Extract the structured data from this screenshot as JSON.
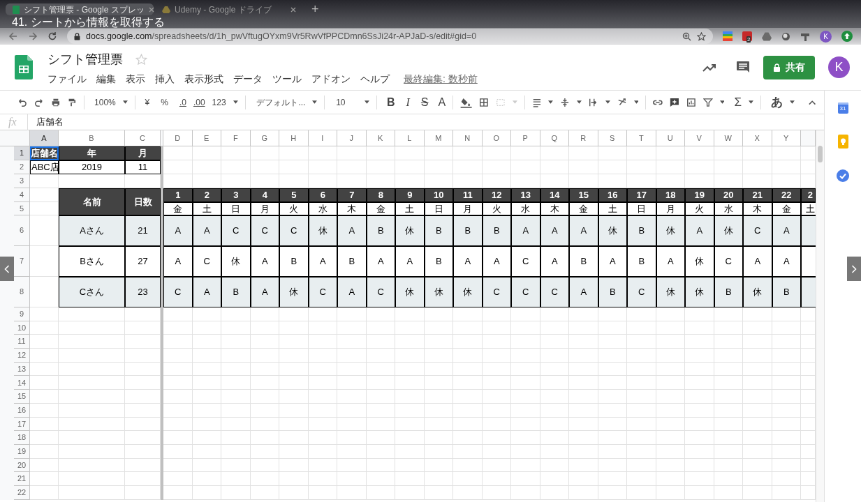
{
  "video_title": "41. シートから情報を取得する",
  "browser": {
    "tabs": [
      {
        "title": "シフト管理票 - Google スプレッ",
        "selected": true
      },
      {
        "title": "Udemy - Google ドライブ",
        "selected": false
      }
    ],
    "new_tab": "+",
    "url_host": "docs.google.com",
    "url_path": "/spreadsheets/d/1h_pwVftugOYxm9Vr5RwVfPPCDmn6SsJi24r-APJaD-s/edit#gid=0",
    "extension_badge": "2",
    "profile_initial": "K"
  },
  "doc": {
    "title": "シフト管理票",
    "menu": [
      "ファイル",
      "編集",
      "表示",
      "挿入",
      "表示形式",
      "データ",
      "ツール",
      "アドオン",
      "ヘルプ"
    ],
    "last_edit": "最終編集: 数秒前",
    "share_label": "共有",
    "avatar_initial": "K"
  },
  "toolbar": {
    "zoom": "100%",
    "currency": "¥",
    "percent": "%",
    "decimal_less": ".0",
    "decimal_more": ".00",
    "number_format": "123",
    "font": "デフォルト...",
    "font_size": "10",
    "bold": "B",
    "italic": "I",
    "strike": "S",
    "text_color": "A",
    "function": "Σ",
    "input_tool": "あ"
  },
  "formula_bar": {
    "fx": "fx",
    "value": "店舗名"
  },
  "sheet": {
    "columns": [
      {
        "label": "A",
        "selected": true
      },
      {
        "label": "B",
        "selected": false
      },
      {
        "label": "C",
        "selected": false
      },
      {
        "label": "D",
        "selected": false
      },
      {
        "label": "E",
        "selected": false
      },
      {
        "label": "F",
        "selected": false
      },
      {
        "label": "G",
        "selected": false
      },
      {
        "label": "H",
        "selected": false
      },
      {
        "label": "I",
        "selected": false
      },
      {
        "label": "J",
        "selected": false
      },
      {
        "label": "K",
        "selected": false
      },
      {
        "label": "L",
        "selected": false
      },
      {
        "label": "M",
        "selected": false
      },
      {
        "label": "N",
        "selected": false
      },
      {
        "label": "O",
        "selected": false
      },
      {
        "label": "P",
        "selected": false
      },
      {
        "label": "Q",
        "selected": false
      },
      {
        "label": "R",
        "selected": false
      },
      {
        "label": "S",
        "selected": false
      },
      {
        "label": "T",
        "selected": false
      },
      {
        "label": "U",
        "selected": false
      },
      {
        "label": "V",
        "selected": false
      },
      {
        "label": "W",
        "selected": false
      },
      {
        "label": "X",
        "selected": false
      },
      {
        "label": "Y",
        "selected": false
      }
    ],
    "rows": [
      {
        "label": "1",
        "selected": true
      },
      {
        "label": "2",
        "selected": false
      },
      {
        "label": "3",
        "selected": false
      },
      {
        "label": "4",
        "selected": false
      },
      {
        "label": "5",
        "selected": false
      },
      {
        "label": "6",
        "selected": false
      },
      {
        "label": "7",
        "selected": false
      },
      {
        "label": "8",
        "selected": false
      },
      {
        "label": "9",
        "selected": false
      },
      {
        "label": "10",
        "selected": false
      },
      {
        "label": "11",
        "selected": false
      },
      {
        "label": "12",
        "selected": false
      },
      {
        "label": "13",
        "selected": false
      },
      {
        "label": "14",
        "selected": false
      },
      {
        "label": "15",
        "selected": false
      },
      {
        "label": "16",
        "selected": false
      },
      {
        "label": "17",
        "selected": false
      },
      {
        "label": "18",
        "selected": false
      },
      {
        "label": "19",
        "selected": false
      },
      {
        "label": "20",
        "selected": false
      },
      {
        "label": "21",
        "selected": false
      },
      {
        "label": "22",
        "selected": false
      }
    ],
    "info_headers": [
      "店舗名",
      "年",
      "月"
    ],
    "info_values": [
      "ABC店",
      "2019",
      "11"
    ],
    "staff_headers": [
      "名前",
      "日数"
    ],
    "days": [
      {
        "day": "1",
        "weekday": "金"
      },
      {
        "day": "2",
        "weekday": "土"
      },
      {
        "day": "3",
        "weekday": "日"
      },
      {
        "day": "4",
        "weekday": "月"
      },
      {
        "day": "5",
        "weekday": "火"
      },
      {
        "day": "6",
        "weekday": "水"
      },
      {
        "day": "7",
        "weekday": "木"
      },
      {
        "day": "8",
        "weekday": "金"
      },
      {
        "day": "9",
        "weekday": "土"
      },
      {
        "day": "10",
        "weekday": "日"
      },
      {
        "day": "11",
        "weekday": "月"
      },
      {
        "day": "12",
        "weekday": "火"
      },
      {
        "day": "13",
        "weekday": "水"
      },
      {
        "day": "14",
        "weekday": "木"
      },
      {
        "day": "15",
        "weekday": "金"
      },
      {
        "day": "16",
        "weekday": "土"
      },
      {
        "day": "17",
        "weekday": "日"
      },
      {
        "day": "18",
        "weekday": "月"
      },
      {
        "day": "19",
        "weekday": "火"
      },
      {
        "day": "20",
        "weekday": "水"
      },
      {
        "day": "21",
        "weekday": "木"
      },
      {
        "day": "22",
        "weekday": "金"
      }
    ],
    "partial_day": {
      "day": "2",
      "weekday": "土"
    },
    "staff": [
      {
        "name": "Aさん",
        "days": "21",
        "shaded": true,
        "shifts": [
          "A",
          "A",
          "C",
          "C",
          "C",
          "休",
          "A",
          "B",
          "休",
          "B",
          "B",
          "B",
          "A",
          "A",
          "A",
          "休",
          "B",
          "休",
          "A",
          "休",
          "C",
          "A"
        ]
      },
      {
        "name": "Bさん",
        "days": "27",
        "shaded": false,
        "shifts": [
          "A",
          "C",
          "休",
          "A",
          "B",
          "A",
          "B",
          "A",
          "A",
          "B",
          "A",
          "A",
          "C",
          "A",
          "B",
          "A",
          "B",
          "A",
          "休",
          "C",
          "A",
          "A"
        ]
      },
      {
        "name": "Cさん",
        "days": "23",
        "shaded": true,
        "shifts": [
          "C",
          "A",
          "B",
          "A",
          "休",
          "C",
          "A",
          "C",
          "休",
          "休",
          "休",
          "C",
          "C",
          "C",
          "A",
          "B",
          "C",
          "休",
          "休",
          "B",
          "休",
          "B"
        ]
      }
    ]
  },
  "side_panel": {
    "calendar_date": "31"
  }
}
